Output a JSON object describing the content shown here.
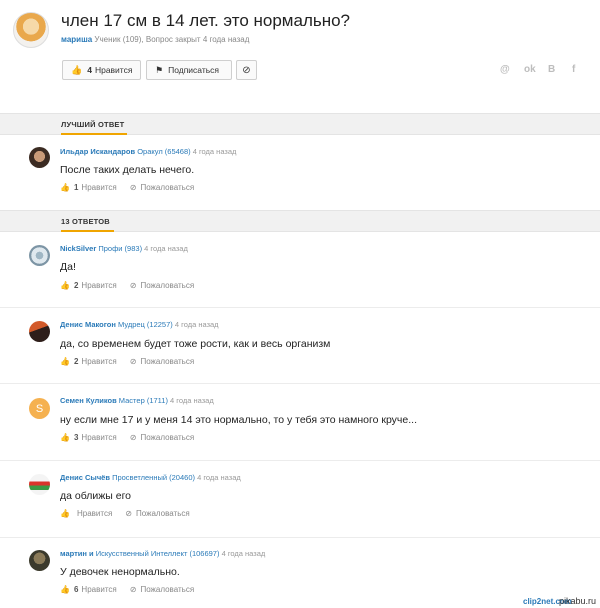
{
  "question": {
    "title": "член 17 см в 14 лет. это нормально?",
    "author": "мариша",
    "author_rank": "Ученик (109),",
    "status": "Вопрос закрыт 4 года назад",
    "like_count": "4",
    "like_label": "Нравится",
    "subscribe_label": "Подписаться"
  },
  "share_icons": [
    "@",
    "ok",
    "B",
    "f"
  ],
  "best_answer": {
    "section_label": "ЛУЧШИЙ ОТВЕТ",
    "name": "Ильдар Искандаров",
    "rank": "Оракул (65468)",
    "time": "4 года назад",
    "text": "После таких делать нечего.",
    "likes": "1",
    "like_label": "Нравится",
    "report_label": "Пожаловаться"
  },
  "answers_section_label": "13 ОТВЕТОВ",
  "answers": [
    {
      "name": "NickSilver",
      "rank": "Профи (983)",
      "time": "4 года назад",
      "text": "Да!",
      "likes": "2",
      "like_label": "Нравится",
      "report_label": "Пожаловаться"
    },
    {
      "name": "Денис Макогон",
      "rank": "Мудрец (12257)",
      "time": "4 года назад",
      "text": "да, со временем будет тоже рости, как и весь организм",
      "likes": "2",
      "like_label": "Нравится",
      "report_label": "Пожаловаться"
    },
    {
      "name": "Семен Куликов",
      "rank": "Мастер (1711)",
      "time": "4 года назад",
      "text": "ну если мне 17 и у меня 14 это нормально, то у тебя это намного круче...",
      "likes": "3",
      "like_label": "Нравится",
      "report_label": "Пожаловаться"
    },
    {
      "name": "Денис Сычёв",
      "rank": "Просветленный (20460)",
      "time": "4 года назад",
      "text": "да оближы его",
      "likes": "",
      "like_label": "Нравится",
      "report_label": "Пожаловаться"
    },
    {
      "name": "мартин и",
      "rank": "Искусственный Интеллект (106697)",
      "time": "4 года назад",
      "text": "У девочек ненормально.",
      "likes": "6",
      "like_label": "Нравится",
      "report_label": "Пожаловаться"
    }
  ],
  "watermark": "pikabu.ru",
  "watermark2": "clip2net.com",
  "colors": {
    "link": "#2a7ab8",
    "accent": "#f0a500",
    "section_bg": "#f1f1f1"
  }
}
